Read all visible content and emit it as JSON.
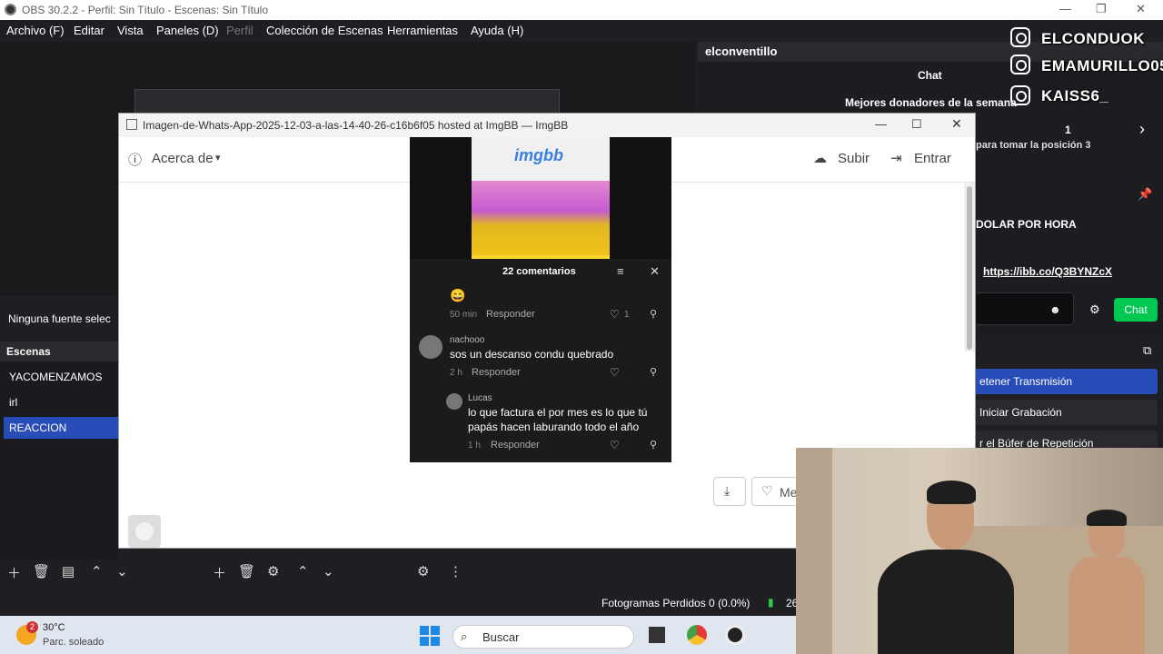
{
  "window": {
    "title": "OBS 30.2.2 - Perfil: Sin Título - Escenas: Sin Título",
    "controls": [
      "—",
      "❐",
      "✕"
    ]
  },
  "menu": [
    "Archivo (F)",
    "Editar",
    "Vista",
    "Paneles (D)",
    "Perfil",
    "Colección de Escenas",
    "Herramientas",
    "Ayuda (H)"
  ],
  "dock": {
    "title": "elconventillo",
    "chat_header": "Chat",
    "donors": "Mejores donadores de la semana",
    "count": "1",
    "position_text": "para tomar la posición 3",
    "dollar_text": "DOLAR POR HORA",
    "link": "https://ibb.co/Q3BYNZcX",
    "chat_button": "Chat"
  },
  "controls": {
    "stop_stream": "etener Transmisión",
    "start_recording": "Iniciar Grabación",
    "replay_buffer": "r el Búfer de Repetición"
  },
  "sources": {
    "empty_text": "Ninguna fuente selec"
  },
  "scenes": {
    "header": "Escenas",
    "items": [
      {
        "label": "YACOMENZAMOS",
        "active": false
      },
      {
        "label": "irl",
        "active": false
      },
      {
        "label": "REACCION",
        "active": true
      }
    ]
  },
  "status": {
    "frames": "Fotogramas Perdidos 0 (0.0%)",
    "extra": "26"
  },
  "taskbar": {
    "weather_badge": "2",
    "temp": "30°C",
    "desc": "Parc. soleado",
    "search": "Buscar"
  },
  "browser": {
    "title": "Imagen-de-Whats-App-2025-12-03-a-las-14-40-26-c16b6f05 hosted at ImgBB — ImgBB",
    "about": "Acerca de",
    "upload": "Subir",
    "login": "Entrar",
    "logo": "imgbb",
    "like_button": "Me"
  },
  "comments": {
    "header": "22 comentarios",
    "list": [
      {
        "name": "",
        "text": "😄",
        "time": "50 min",
        "reply": "Responder",
        "likes": "1"
      },
      {
        "name": "nachooo",
        "text": "sos un descanso condu quebrado",
        "time": "2 h",
        "reply": "Responder",
        "likes": ""
      },
      {
        "name": "Lucas",
        "text": "lo que factura el por mes es lo que tú",
        "text2": "papás hacen laburando todo el año",
        "time": "1 h",
        "reply": "Responder",
        "likes": ""
      }
    ]
  },
  "overlay": {
    "handles": [
      "ELCONDUOK",
      "EMAMURILLO05",
      "KAISS6_"
    ]
  },
  "colors": {
    "accent": "#284cb8",
    "chat_green": "#00c853",
    "link_blue": "#3a80e0"
  }
}
